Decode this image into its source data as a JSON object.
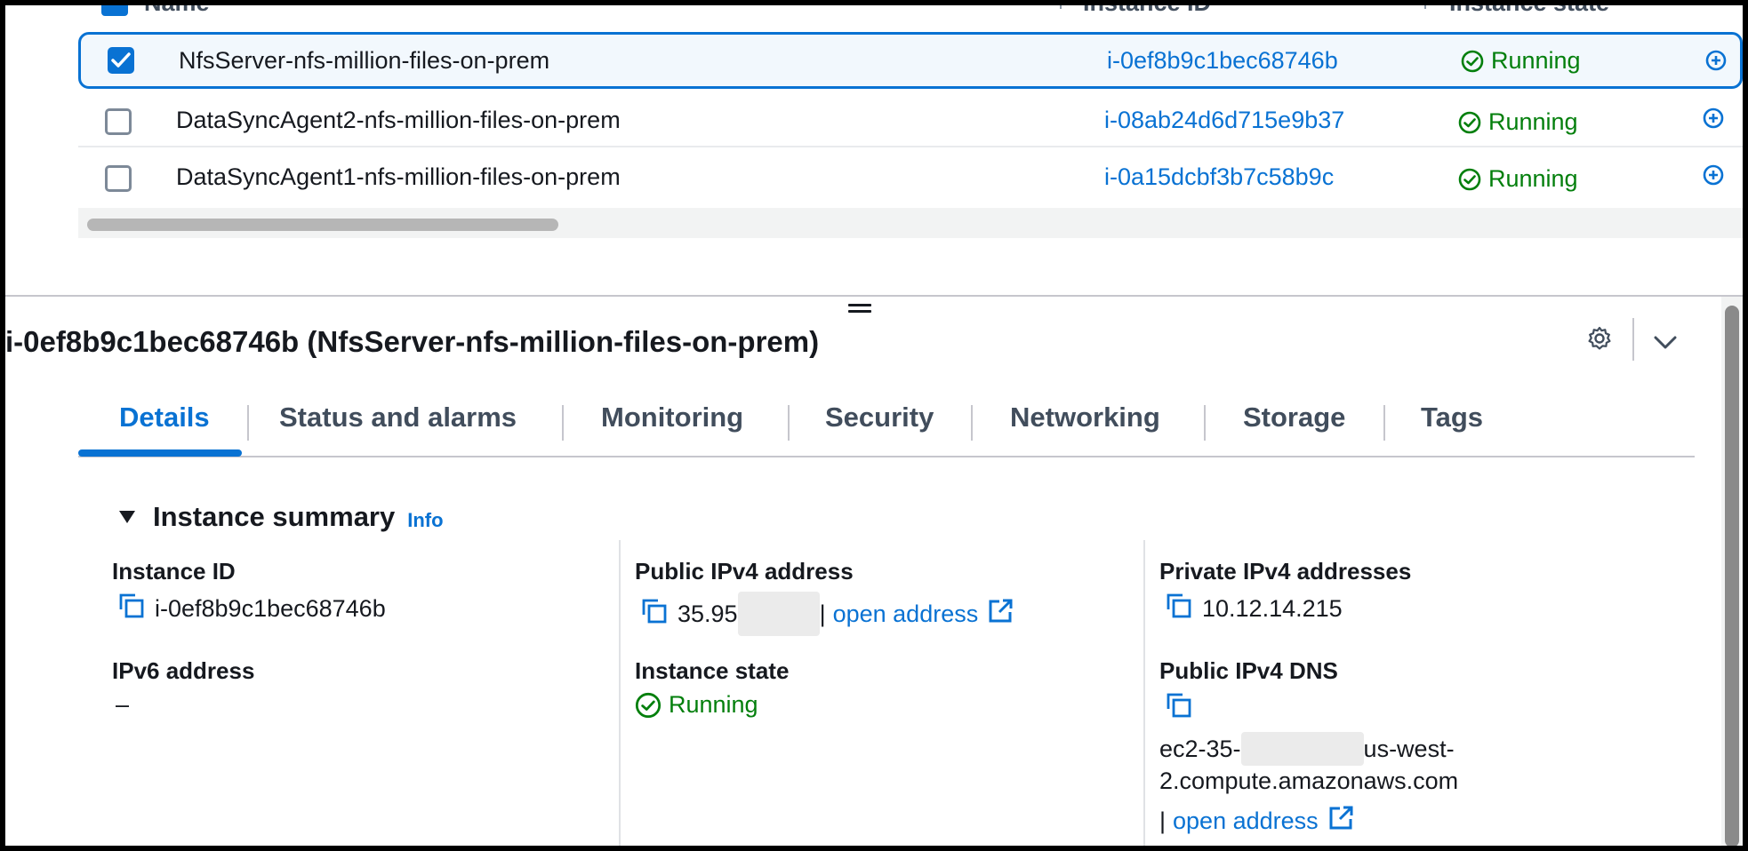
{
  "table": {
    "columns": [
      {
        "label": "Name"
      },
      {
        "label": "Instance ID"
      },
      {
        "label": "Instance state"
      }
    ],
    "rows": [
      {
        "name": "NfsServer-nfs-million-files-on-prem",
        "instance_id": "i-0ef8b9c1bec68746b",
        "state": "Running",
        "selected": true
      },
      {
        "name": "DataSyncAgent2-nfs-million-files-on-prem",
        "instance_id": "i-08ab24d6d715e9b37",
        "state": "Running",
        "selected": false
      },
      {
        "name": "DataSyncAgent1-nfs-million-files-on-prem",
        "instance_id": "i-0a15dcbf3b7c58b9c",
        "state": "Running",
        "selected": false
      }
    ]
  },
  "details": {
    "title": "i-0ef8b9c1bec68746b (NfsServer-nfs-million-files-on-prem)",
    "tabs": [
      "Details",
      "Status and alarms",
      "Monitoring",
      "Security",
      "Networking",
      "Storage",
      "Tags"
    ],
    "active_tab": "Details",
    "section": {
      "title": "Instance summary",
      "info": "Info"
    },
    "fields": {
      "instance_id": {
        "label": "Instance ID",
        "value": "i-0ef8b9c1bec68746b"
      },
      "ipv6": {
        "label": "IPv6 address",
        "value": "–"
      },
      "public_ipv4": {
        "label": "Public IPv4 address",
        "value": "35.95",
        "separator": "|",
        "link": "open address"
      },
      "instance_state": {
        "label": "Instance state",
        "value": "Running"
      },
      "private_ipv4": {
        "label": "Private IPv4 addresses",
        "value": "10.12.14.215"
      },
      "public_dns": {
        "label": "Public IPv4 DNS",
        "value_prefix": "ec2-35-",
        "value_mid": "us-west-",
        "value_line2": "2.compute.amazonaws.com",
        "separator": "|",
        "link": "open address"
      }
    }
  },
  "icons": {
    "check": "check-icon",
    "status_ok": "status-positive-icon",
    "copy": "copy-icon",
    "external": "external-link-icon",
    "settings": "gear-icon",
    "collapse": "chevron-down-icon",
    "zoom": "zoom-in-icon"
  },
  "colors": {
    "accent": "#0972d3",
    "success": "#037f0c",
    "text": "#16191f"
  }
}
